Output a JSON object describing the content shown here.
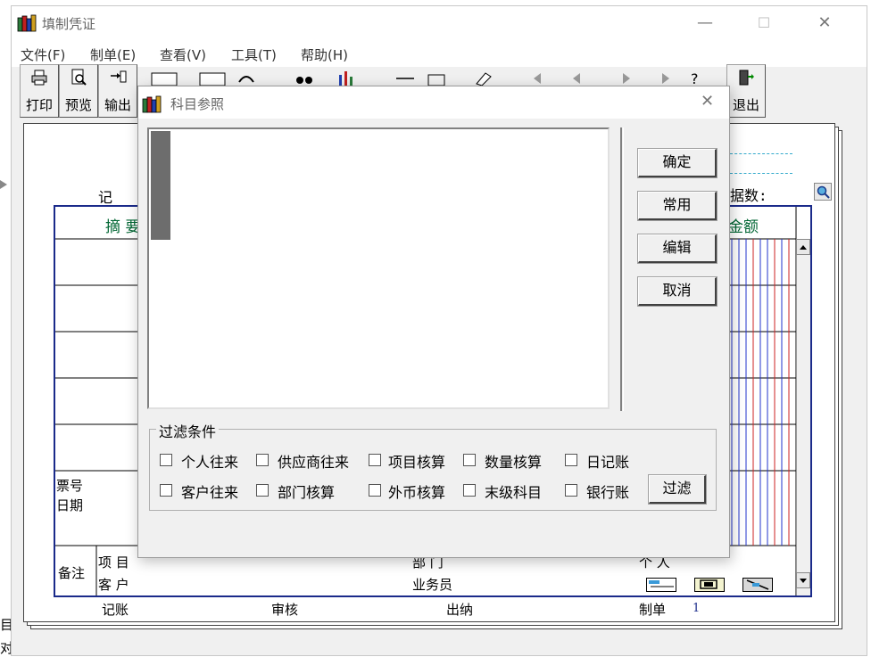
{
  "window": {
    "title": "填制凭证",
    "minimize_glyph": "—",
    "maximize_glyph": "☐",
    "close_glyph": "✕"
  },
  "menu": [
    {
      "label": "文件(F)"
    },
    {
      "label": "制单(E)"
    },
    {
      "label": "查看(V)"
    },
    {
      "label": "工具(T)"
    },
    {
      "label": "帮助(H)"
    }
  ],
  "toolbar": {
    "print": "打印",
    "preview": "预览",
    "export": "输出",
    "exit": "退出"
  },
  "voucher": {
    "type_label": "记",
    "doc_count_label": "据数:",
    "col_summary": "摘 要",
    "col_amount": "金额",
    "ticket_no": "票号",
    "date": "日期",
    "remark": "备注",
    "project": "项 目",
    "customer": "客 户",
    "department": "部 门",
    "individual": "个 人",
    "salesperson": "业务员",
    "bookkeeper": "记账",
    "reviewer": "审核",
    "cashier": "出纳",
    "maker": "制单",
    "maker_value": "1"
  },
  "left_edge": {
    "line1": "目",
    "line2": "对账"
  },
  "dialog": {
    "title": "科目参照",
    "close_glyph": "✕",
    "buttons": {
      "ok": "确定",
      "common": "常用",
      "edit": "编辑",
      "cancel": "取消",
      "filter": "过滤"
    },
    "filter_title": "过滤条件",
    "filters": [
      {
        "label": "个人往来",
        "checked": false
      },
      {
        "label": "供应商往来",
        "checked": false
      },
      {
        "label": "项目核算",
        "checked": false
      },
      {
        "label": "数量核算",
        "checked": false
      },
      {
        "label": "日记账",
        "checked": false
      },
      {
        "label": "客户往来",
        "checked": false
      },
      {
        "label": "部门核算",
        "checked": false
      },
      {
        "label": "外币核算",
        "checked": false
      },
      {
        "label": "末级科目",
        "checked": false
      },
      {
        "label": "银行账",
        "checked": false
      }
    ]
  },
  "colors": {
    "grid_border": "#1a2a8a",
    "amount_blue": "#2233cc",
    "amount_red": "#cc2222",
    "summary_text": "#006633"
  }
}
